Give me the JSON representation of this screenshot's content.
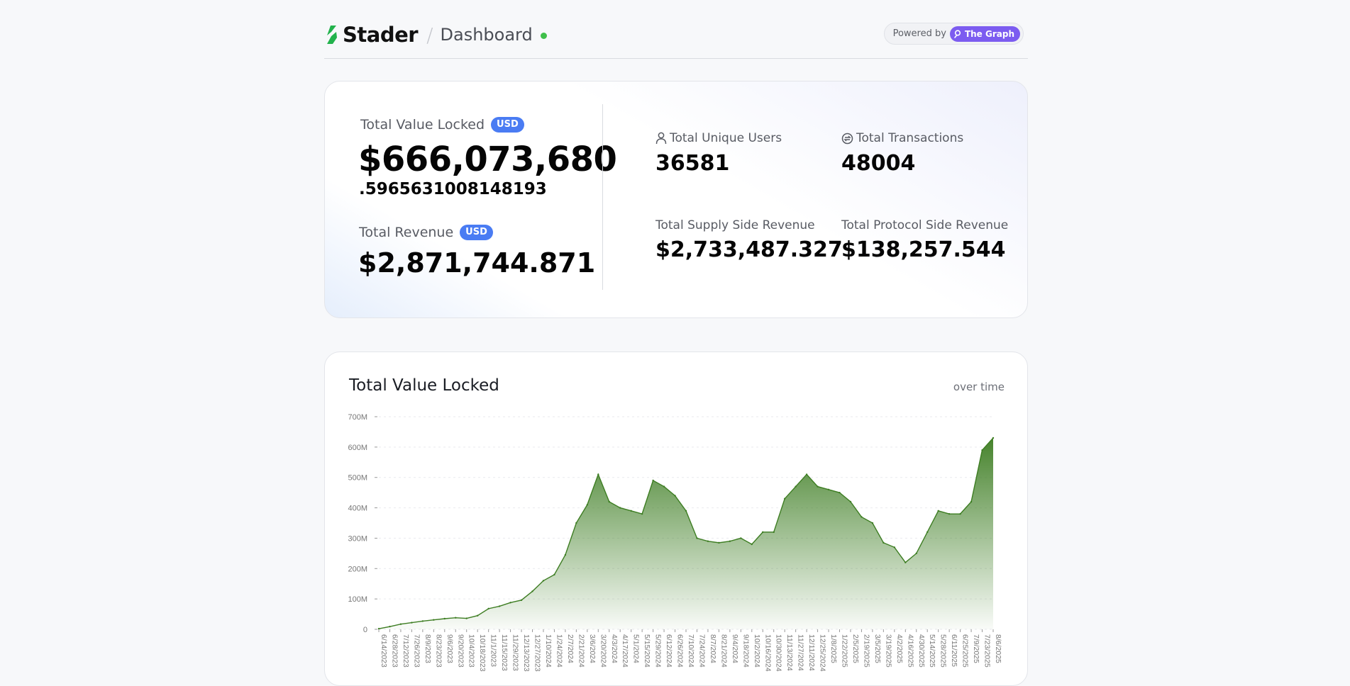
{
  "header": {
    "brand": "Stader",
    "separator": "/",
    "page": "Dashboard",
    "powered_by": "Powered by",
    "graph_label": "The Graph",
    "accent_green": "#3fbf4a",
    "graph_color": "#7c5cf0"
  },
  "stats": {
    "tvl_label": "Total Value Locked",
    "tvl_badge": "USD",
    "tvl_main": "$666,073,680",
    "tvl_decimal": ".5965631008148193",
    "revenue_label": "Total Revenue",
    "revenue_badge": "USD",
    "revenue_value": "$2,871,744.871",
    "users_label": "Total Unique Users",
    "users_value": "36581",
    "tx_label": "Total Transactions",
    "tx_value": "48004",
    "supply_label": "Total Supply Side Revenue",
    "supply_value": "$2,733,487.327",
    "protocol_label": "Total Protocol Side Revenue",
    "protocol_value": "$138,257.544",
    "badge_color": "#4a7cf3"
  },
  "chart_data": {
    "type": "area",
    "title": "Total Value Locked",
    "subtitle": "over time",
    "ylim": [
      0,
      700000000
    ],
    "y_ticks": [
      "0",
      "100M",
      "200M",
      "300M",
      "400M",
      "500M",
      "600M",
      "700M"
    ],
    "x_tick_labels": [
      "6/14/2023",
      "6/28/2023",
      "7/12/2023",
      "7/26/2023",
      "8/9/2023",
      "8/23/2023",
      "9/6/2023",
      "9/20/2023",
      "10/4/2023",
      "10/18/2023",
      "11/1/2023",
      "11/15/2023",
      "11/29/2023",
      "12/13/2023",
      "12/27/2023",
      "1/10/2024",
      "1/24/2024",
      "2/7/2024",
      "2/21/2024",
      "3/6/2024",
      "3/20/2024",
      "4/3/2024",
      "4/17/2024",
      "5/1/2024",
      "5/15/2024",
      "5/29/2024",
      "6/12/2024",
      "6/26/2024",
      "7/10/2024",
      "7/24/2024",
      "8/7/2024",
      "8/21/2024",
      "9/4/2024",
      "9/18/2024",
      "10/2/2024",
      "10/16/2024",
      "10/30/2024",
      "11/13/2024",
      "11/27/2024",
      "12/11/2024",
      "12/25/2024",
      "1/8/2025",
      "1/22/2025",
      "2/5/2025",
      "2/19/2025",
      "3/5/2025",
      "3/19/2025",
      "4/2/2025",
      "4/16/2025",
      "4/30/2025",
      "5/14/2025",
      "5/28/2025",
      "6/11/2025",
      "6/25/2025",
      "7/9/2025",
      "7/23/2025",
      "8/6/2025"
    ],
    "series": [
      {
        "color": "#3d7d22",
        "x": [
          "6/14/2023",
          "6/28/2023",
          "7/12/2023",
          "7/26/2023",
          "8/9/2023",
          "8/23/2023",
          "9/6/2023",
          "9/20/2023",
          "10/4/2023",
          "10/18/2023",
          "11/1/2023",
          "11/15/2023",
          "11/29/2023",
          "12/13/2023",
          "12/27/2023",
          "1/10/2024",
          "1/24/2024",
          "2/7/2024",
          "2/21/2024",
          "3/6/2024",
          "3/20/2024",
          "4/3/2024",
          "4/17/2024",
          "5/1/2024",
          "5/15/2024",
          "5/29/2024",
          "6/12/2024",
          "6/26/2024",
          "7/10/2024",
          "7/24/2024",
          "8/7/2024",
          "8/21/2024",
          "9/4/2024",
          "9/18/2024",
          "10/2/2024",
          "10/16/2024",
          "10/30/2024",
          "11/13/2024",
          "11/27/2024",
          "12/11/2024",
          "12/25/2024",
          "1/8/2025",
          "1/22/2025",
          "2/5/2025",
          "2/19/2025",
          "3/5/2025",
          "3/19/2025",
          "4/2/2025",
          "4/16/2025",
          "4/30/2025",
          "5/14/2025",
          "5/28/2025",
          "6/11/2025",
          "6/25/2025",
          "7/9/2025",
          "7/23/2025",
          "8/6/2025"
        ],
        "values": [
          2000000,
          9000000,
          17000000,
          22000000,
          27000000,
          31000000,
          35000000,
          38000000,
          36000000,
          45000000,
          68000000,
          76000000,
          88000000,
          96000000,
          125000000,
          160000000,
          180000000,
          245000000,
          350000000,
          410000000,
          510000000,
          420000000,
          400000000,
          390000000,
          380000000,
          490000000,
          470000000,
          440000000,
          390000000,
          300000000,
          290000000,
          285000000,
          290000000,
          300000000,
          280000000,
          320000000,
          320000000,
          430000000,
          470000000,
          510000000,
          470000000,
          460000000,
          450000000,
          420000000,
          370000000,
          350000000,
          285000000,
          270000000,
          220000000,
          250000000,
          320000000,
          390000000,
          380000000,
          380000000,
          420000000,
          590000000,
          630000000
        ]
      }
    ]
  }
}
